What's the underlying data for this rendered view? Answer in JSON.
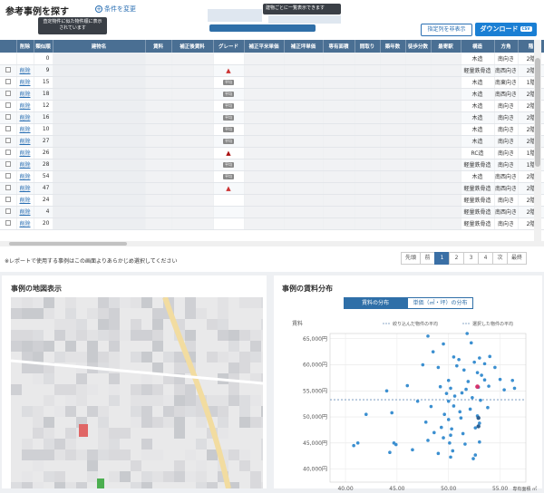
{
  "header": {
    "title": "参考事例を探す",
    "change_conditions": "条件を変更",
    "tooltip_left": "査定物件に似た物件順に表示されています",
    "tooltip_right": "建物ごとに一覧表示できます",
    "hide_columns_button": "指定列を非表示",
    "download_button": "ダウンロード",
    "download_badge": "CSV"
  },
  "table": {
    "columns": [
      "",
      "削除",
      "類似順",
      "建物名",
      "賃料",
      "補正後賃料",
      "グレード",
      "補正平米単価",
      "補正坪単価",
      "専有面積",
      "間取り",
      "築年数",
      "徒歩分数",
      "最寄駅",
      "構造",
      "方角",
      "階"
    ],
    "rows": [
      {
        "action": "",
        "rank": "0",
        "grade": "",
        "structure": "木造",
        "direction": "南向き",
        "floor": "2階"
      },
      {
        "action": "削除",
        "rank": "9",
        "grade": "tri",
        "structure": "軽量鉄骨造",
        "direction": "南西向き",
        "floor": "2階"
      },
      {
        "action": "削除",
        "rank": "15",
        "grade": "badge",
        "structure": "木造",
        "direction": "南東向き",
        "floor": "1階"
      },
      {
        "action": "削除",
        "rank": "18",
        "grade": "badge",
        "structure": "木造",
        "direction": "南西向き",
        "floor": "2階"
      },
      {
        "action": "削除",
        "rank": "12",
        "grade": "badge",
        "structure": "木造",
        "direction": "南向き",
        "floor": "2階"
      },
      {
        "action": "削除",
        "rank": "16",
        "grade": "badge",
        "structure": "木造",
        "direction": "南向き",
        "floor": "2階"
      },
      {
        "action": "削除",
        "rank": "10",
        "grade": "badge",
        "structure": "木造",
        "direction": "南向き",
        "floor": "2階"
      },
      {
        "action": "削除",
        "rank": "27",
        "grade": "badge",
        "structure": "木造",
        "direction": "南向き",
        "floor": "2階"
      },
      {
        "action": "削除",
        "rank": "26",
        "grade": "tri-dark",
        "structure": "RC造",
        "direction": "南向き",
        "floor": "1階"
      },
      {
        "action": "削除",
        "rank": "28",
        "grade": "badge",
        "structure": "軽量鉄骨造",
        "direction": "南向き",
        "floor": "1階"
      },
      {
        "action": "削除",
        "rank": "54",
        "grade": "badge",
        "structure": "木造",
        "direction": "南西向き",
        "floor": "2階"
      },
      {
        "action": "削除",
        "rank": "47",
        "grade": "tri",
        "structure": "軽量鉄骨造",
        "direction": "南西向き",
        "floor": "2階"
      },
      {
        "action": "削除",
        "rank": "24",
        "grade": "",
        "structure": "軽量鉄骨造",
        "direction": "南向き",
        "floor": "2階"
      },
      {
        "action": "削除",
        "rank": "4",
        "grade": "",
        "structure": "軽量鉄骨造",
        "direction": "南西向き",
        "floor": "2階"
      },
      {
        "action": "削除",
        "rank": "20",
        "grade": "",
        "structure": "軽量鉄骨造",
        "direction": "南向き",
        "floor": "2階"
      }
    ],
    "grade_badge": "平均"
  },
  "footer_note": "※レポートで使用する事例はこの画面よりあらかじめ選択してください",
  "pagination": {
    "first": "先頭",
    "prev": "前",
    "pages": [
      "1",
      "2",
      "3",
      "4"
    ],
    "next": "次",
    "last": "最終",
    "active": "1"
  },
  "map_panel": {
    "title": "事例の地図表示"
  },
  "chart_panel": {
    "title": "事例の賃料分布",
    "tab_active": "賃料の分布",
    "tab_inactive": "単価（㎡・坪）の分布"
  },
  "chart_data": {
    "type": "scatter",
    "ylabel": "賃料",
    "xlabel": "専有面積 ㎡",
    "ylim": [
      37500,
      66000
    ],
    "xlim": [
      38.5,
      57.5
    ],
    "x_ticks": [
      "40.00",
      "45.00",
      "50.00",
      "55.00"
    ],
    "y_ticks": [
      "40,000円",
      "45,000円",
      "50,000円",
      "55,000円",
      "60,000円",
      "65,000円"
    ],
    "x_tick_values": [
      40,
      45,
      50,
      55
    ],
    "y_tick_values": [
      40000,
      45000,
      50000,
      55000,
      60000,
      65000
    ],
    "legend": [
      "絞り込んだ物件の平均",
      "選択した物件の平均"
    ],
    "avg_line": 53300,
    "color": "#3b8fd0",
    "highlight_color": "#d6336c",
    "dark_color": "#2f5f8f",
    "points": [
      [
        48.0,
        65500
      ],
      [
        51.8,
        66000
      ],
      [
        49.5,
        64000
      ],
      [
        52.2,
        64200
      ],
      [
        48.5,
        62500
      ],
      [
        50.5,
        61500
      ],
      [
        51.0,
        61000
      ],
      [
        53.0,
        61300
      ],
      [
        52.5,
        60500
      ],
      [
        54.0,
        61600
      ],
      [
        47.5,
        60000
      ],
      [
        49.0,
        59500
      ],
      [
        50.8,
        59800
      ],
      [
        53.5,
        60200
      ],
      [
        51.5,
        59000
      ],
      [
        52.8,
        58500
      ],
      [
        54.5,
        59500
      ],
      [
        53.2,
        58000
      ],
      [
        50.0,
        57000
      ],
      [
        51.9,
        56800
      ],
      [
        53.5,
        57100
      ],
      [
        55.0,
        57200
      ],
      [
        56.2,
        57000
      ],
      [
        46.0,
        56000
      ],
      [
        49.2,
        55800
      ],
      [
        50.2,
        55500
      ],
      [
        51.7,
        55300
      ],
      [
        52.9,
        55700
      ],
      [
        53.9,
        55900
      ],
      [
        55.4,
        55200
      ],
      [
        56.4,
        55500
      ],
      [
        44.0,
        55000
      ],
      [
        49.8,
        54500
      ],
      [
        50.6,
        54000
      ],
      [
        51.3,
        54600
      ],
      [
        52.3,
        53700
      ],
      [
        47.0,
        53000
      ],
      [
        50.0,
        53000
      ],
      [
        53.1,
        53200
      ],
      [
        48.3,
        52000
      ],
      [
        50.5,
        52100
      ],
      [
        52.1,
        51500
      ],
      [
        53.8,
        51800
      ],
      [
        51.1,
        51000
      ],
      [
        42.0,
        50500
      ],
      [
        44.5,
        50800
      ],
      [
        49.6,
        50500
      ],
      [
        52.8,
        50200
      ],
      [
        47.8,
        49000
      ],
      [
        50.0,
        49500
      ],
      [
        51.2,
        49800
      ],
      [
        53.0,
        48800
      ],
      [
        49.3,
        48000
      ],
      [
        50.3,
        47700
      ],
      [
        52.6,
        47900
      ],
      [
        48.6,
        47000
      ],
      [
        50.2,
        46500
      ],
      [
        51.4,
        46800
      ],
      [
        41.2,
        45000
      ],
      [
        44.7,
        45000
      ],
      [
        44.9,
        44700
      ],
      [
        48.0,
        45500
      ],
      [
        49.5,
        46000
      ],
      [
        50.1,
        45000
      ],
      [
        51.6,
        44800
      ],
      [
        53.0,
        45200
      ],
      [
        40.8,
        44500
      ],
      [
        46.5,
        43700
      ],
      [
        44.3,
        43200
      ],
      [
        49.0,
        43000
      ],
      [
        50.4,
        43500
      ],
      [
        50.2,
        42300
      ],
      [
        52.4,
        42000
      ],
      [
        52.6,
        42700
      ]
    ],
    "highlight_point": [
      52.8,
      55800
    ],
    "dark_points": [
      [
        52.9,
        49800
      ],
      [
        52.9,
        48200
      ]
    ]
  }
}
